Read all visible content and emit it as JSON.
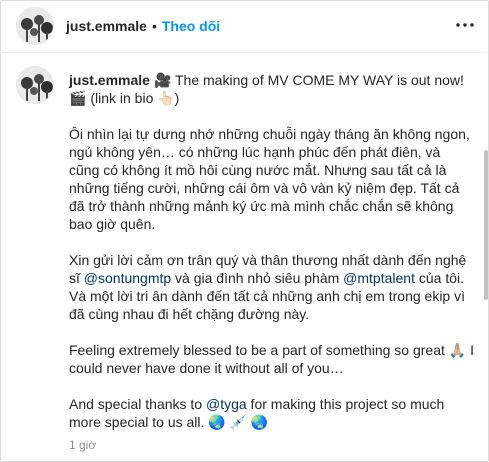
{
  "header": {
    "username": "just.emmale",
    "separator": "•",
    "follow_label": "Theo dõi",
    "more_icon": "ellipsis-icon"
  },
  "caption": {
    "username": "just.emmale",
    "first_line": "🎥 The making of MV COME MY WAY is out now! 🎬 (link in bio 👆🏻)",
    "p1": "Ôi nhìn lại tự dưng nhớ những chuỗi ngày tháng ăn không ngon, ngủ không yên… có những lúc hạnh phúc đến phát điên, và cũng có không ít mồ hôi cùng nước mắt. Nhưng sau tất cả là những tiếng cười, những cái ôm và vô vàn kỷ niệm đẹp. Tất cả đã trở thành những mảnh ký ức mà mình chắc chắn sẽ không bao giờ quên.",
    "p2_a": "Xin gửi lời cảm ơn trân quý và thân thương nhất dành đến nghệ sĩ ",
    "p2_mention1": "@sontungmtp",
    "p2_b": " và gia đình nhỏ siêu phàm ",
    "p2_mention2": "@mtptalent",
    "p2_c": " của tôi. Và một lời tri ân dành đến tất cả những anh chị em trong ekip vì đã cùng nhau đi hết chặng đường này.",
    "p3": "Feeling extremely blessed to be a part of something so great 🙏🏼 I could never have done it without all of you…",
    "p4_a": "And special thanks to ",
    "p4_mention": "@tyga",
    "p4_b": " for making this project so much more special to us all. 🌏 💉 🌏"
  },
  "timestamp": "1 giờ",
  "colors": {
    "link": "#0095f6",
    "mention": "#00376b",
    "muted": "#8e8e8e"
  }
}
